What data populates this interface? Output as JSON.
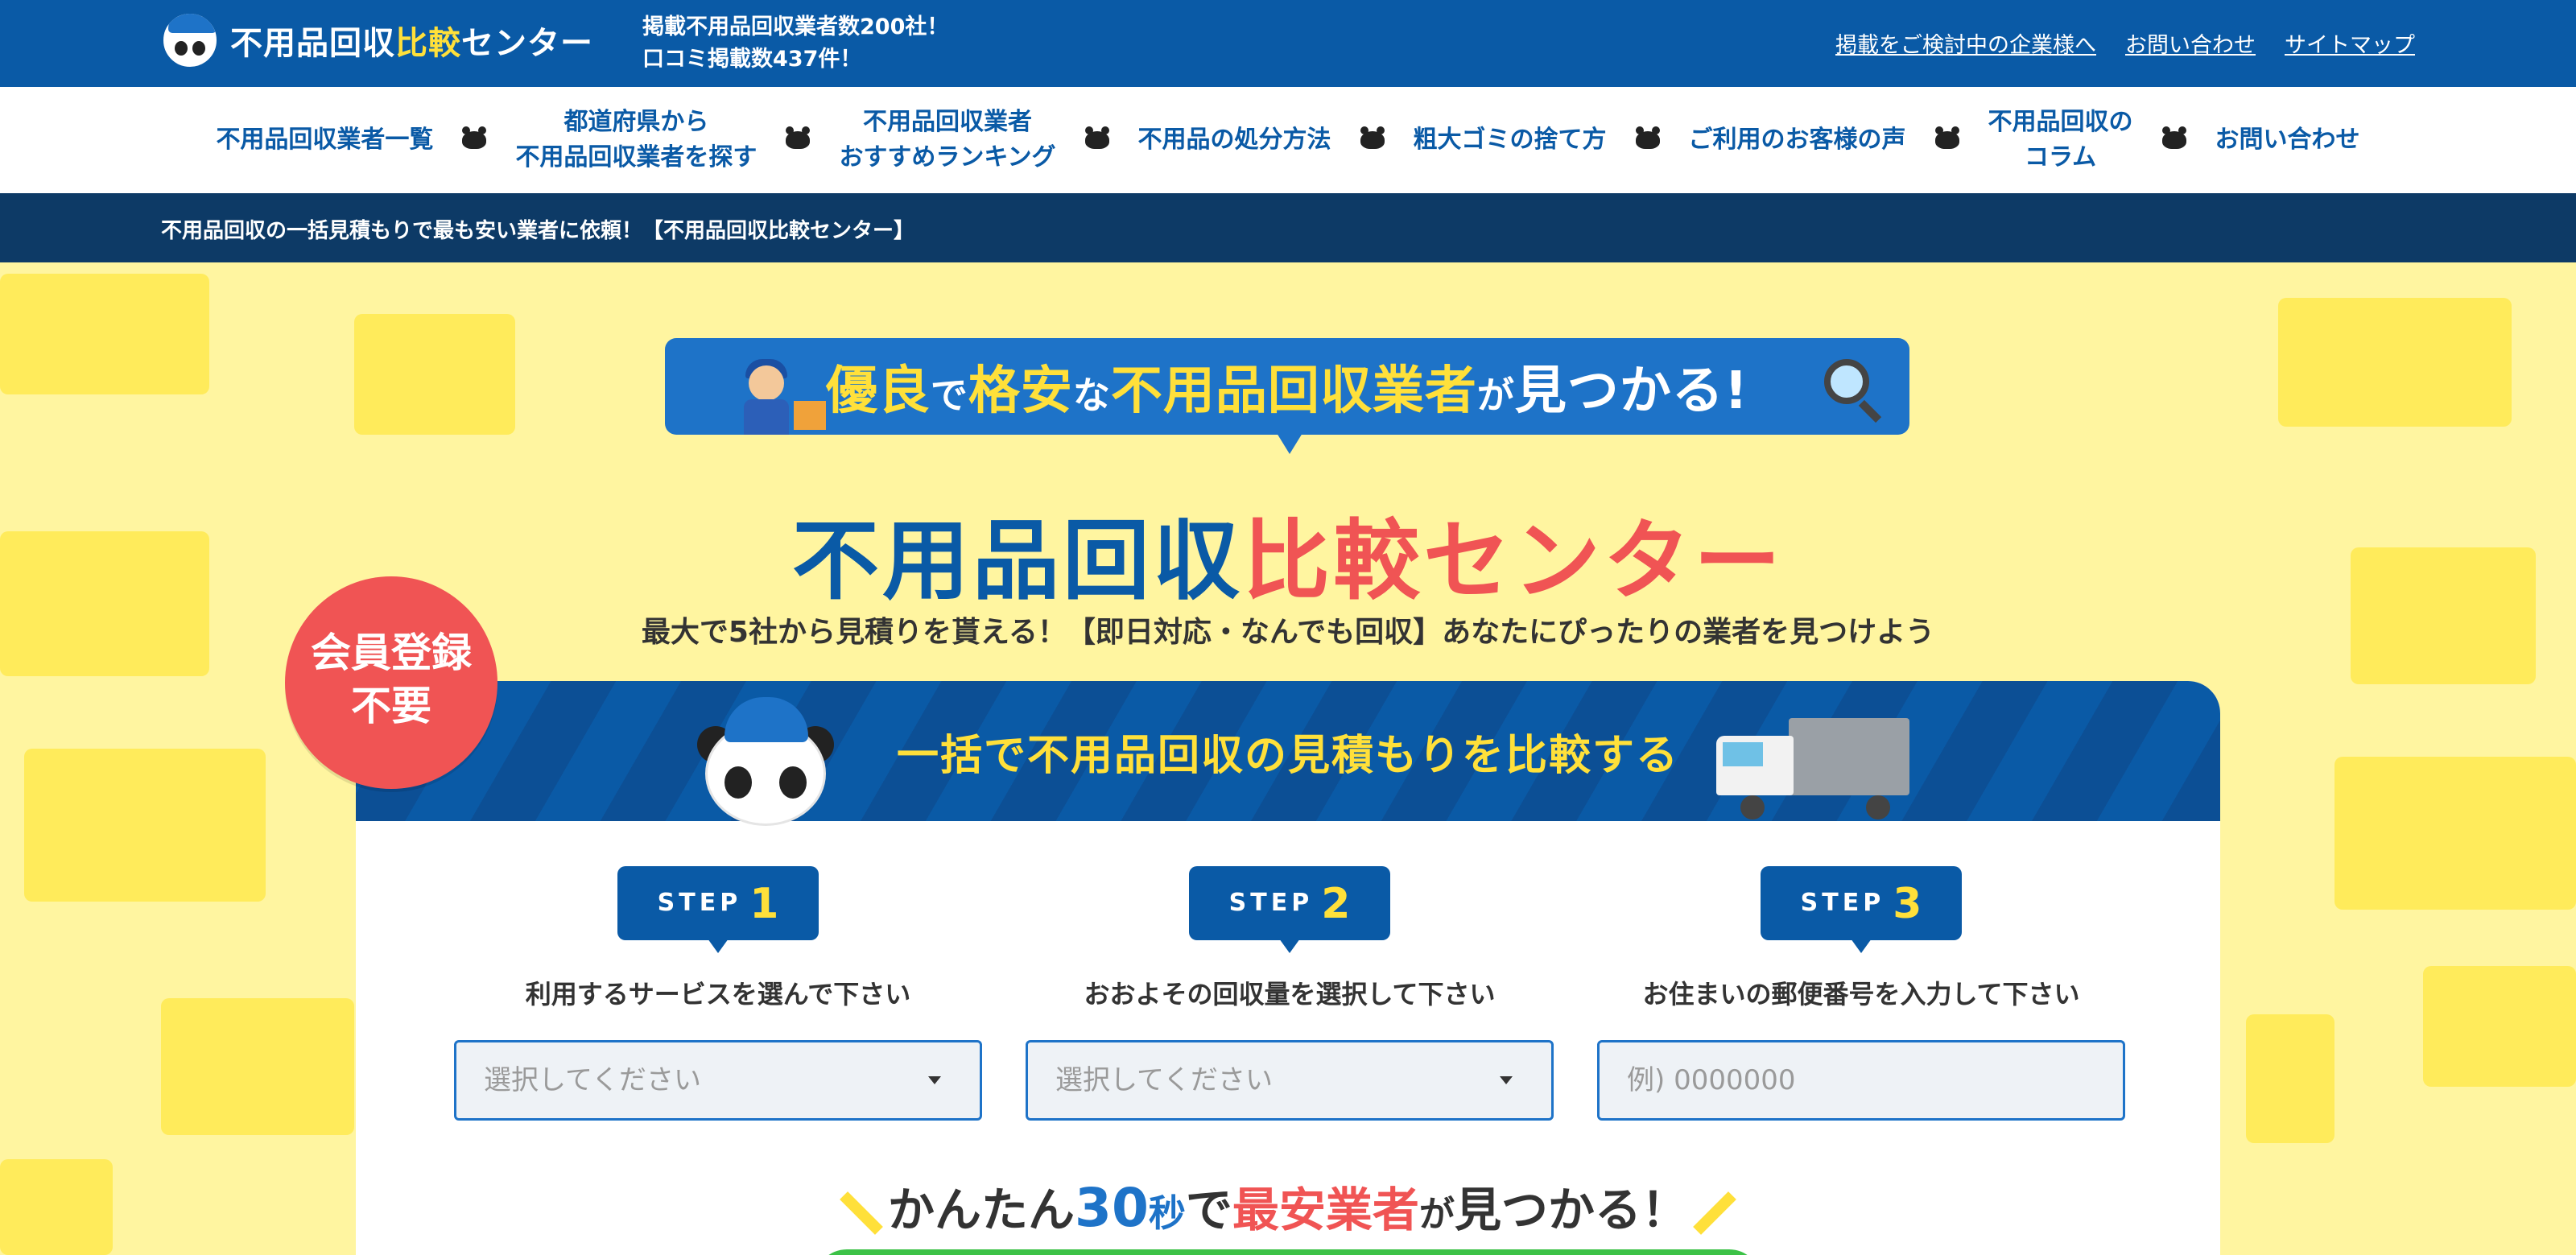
{
  "header": {
    "logo_text_main": "不用品回収",
    "logo_text_accent": "比較",
    "logo_text_end": "センター",
    "stats_line1": "掲載不用品回収業者数200社！",
    "stats_line2": "口コミ掲載数437件！",
    "links": [
      "掲載をご検討中の企業様へ",
      "お問い合わせ",
      "サイトマップ"
    ]
  },
  "nav": {
    "items": [
      {
        "line1": "不用品回収業者一覧",
        "line2": ""
      },
      {
        "line1": "都道府県から",
        "line2": "不用品回収業者を探す"
      },
      {
        "line1": "不用品回収業者",
        "line2": "おすすめランキング"
      },
      {
        "line1": "不用品の処分方法",
        "line2": ""
      },
      {
        "line1": "粗大ゴミの捨て方",
        "line2": ""
      },
      {
        "line1": "ご利用のお客様の声",
        "line2": ""
      },
      {
        "line1": "不用品回収の",
        "line2": "コラム"
      },
      {
        "line1": "お問い合わせ",
        "line2": ""
      }
    ]
  },
  "breadcrumb": "不用品回収の一括見積もりで最も安い業者に依頼！【不用品回収比較センター】",
  "hero": {
    "banner": {
      "p1": "優良",
      "p2": "で",
      "p3": "格安",
      "p4": "な",
      "p5": "不用品回収業者",
      "p6": "が",
      "p7": "見つかる!"
    },
    "title_main": "不用品回収",
    "title_accent": "比較センター",
    "lead": "最大で5社から見積りを貰える！【即日対応・なんでも回収】あなたにぴったりの業者を見つけよう",
    "badge_line1": "会員登録",
    "badge_line2": "不要"
  },
  "form": {
    "heading": "一括で不用品回収の見積もりを比較する",
    "step_word": "STEP",
    "steps": [
      {
        "num": "1",
        "label": "利用するサービスを選んで下さい",
        "placeholder": "選択してください",
        "type": "select"
      },
      {
        "num": "2",
        "label": "おおよその回収量を選択して下さい",
        "placeholder": "選択してください",
        "type": "select"
      },
      {
        "num": "3",
        "label": "お住まいの郵便番号を入力して下さい",
        "placeholder": "例) 0000000",
        "type": "input"
      }
    ],
    "catch": {
      "c1": "かんたん",
      "c2": "30",
      "c3": "秒",
      "c4": "で",
      "c5": "最安業者",
      "c6": "が",
      "c7": "見つかる！"
    }
  },
  "colors": {
    "brand_blue": "#0a5aa6",
    "navy": "#0d3a66",
    "accent_yellow": "#ffe03a",
    "accent_red": "#f05454",
    "hero_bg": "#fff5a0"
  }
}
